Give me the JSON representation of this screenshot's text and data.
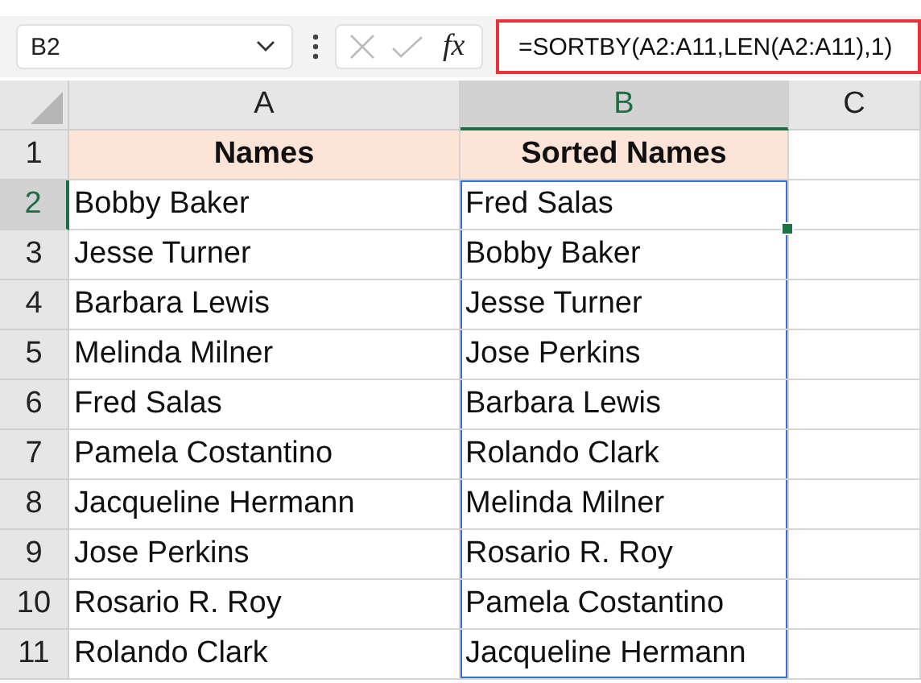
{
  "name_box": {
    "value": "B2"
  },
  "formula_bar": {
    "function_label": "fx",
    "formula": "=SORTBY(A2:A11,LEN(A2:A11),1)",
    "highlighted": true
  },
  "columns": [
    {
      "label": "A",
      "selected": false
    },
    {
      "label": "B",
      "selected": true
    },
    {
      "label": "C",
      "selected": false
    }
  ],
  "rows": [
    {
      "number": "1",
      "selected": false,
      "cells": [
        {
          "text": "Names",
          "kind": "heading",
          "selected": false,
          "in_spill": false
        },
        {
          "text": "Sorted Names",
          "kind": "heading",
          "selected": false,
          "in_spill": false
        }
      ]
    },
    {
      "number": "2",
      "selected": true,
      "cells": [
        {
          "text": "Bobby Baker",
          "kind": "plain",
          "selected": false,
          "in_spill": false
        },
        {
          "text": "Fred Salas",
          "kind": "plain",
          "selected": true,
          "in_spill": true
        }
      ]
    },
    {
      "number": "3",
      "selected": false,
      "cells": [
        {
          "text": "Jesse Turner",
          "kind": "plain",
          "selected": false,
          "in_spill": false
        },
        {
          "text": "Bobby Baker",
          "kind": "plain",
          "selected": false,
          "in_spill": true
        }
      ]
    },
    {
      "number": "4",
      "selected": false,
      "cells": [
        {
          "text": "Barbara Lewis",
          "kind": "plain",
          "selected": false,
          "in_spill": false
        },
        {
          "text": "Jesse Turner",
          "kind": "plain",
          "selected": false,
          "in_spill": true
        }
      ]
    },
    {
      "number": "5",
      "selected": false,
      "cells": [
        {
          "text": "Melinda Milner",
          "kind": "plain",
          "selected": false,
          "in_spill": false
        },
        {
          "text": "Jose Perkins",
          "kind": "plain",
          "selected": false,
          "in_spill": true
        }
      ]
    },
    {
      "number": "6",
      "selected": false,
      "cells": [
        {
          "text": "Fred Salas",
          "kind": "plain",
          "selected": false,
          "in_spill": false
        },
        {
          "text": "Barbara Lewis",
          "kind": "plain",
          "selected": false,
          "in_spill": true
        }
      ]
    },
    {
      "number": "7",
      "selected": false,
      "cells": [
        {
          "text": "Pamela Costantino",
          "kind": "plain",
          "selected": false,
          "in_spill": false
        },
        {
          "text": "Rolando Clark",
          "kind": "plain",
          "selected": false,
          "in_spill": true
        }
      ]
    },
    {
      "number": "8",
      "selected": false,
      "cells": [
        {
          "text": "Jacqueline Hermann",
          "kind": "plain",
          "selected": false,
          "in_spill": false
        },
        {
          "text": "Melinda Milner",
          "kind": "plain",
          "selected": false,
          "in_spill": true
        }
      ]
    },
    {
      "number": "9",
      "selected": false,
      "cells": [
        {
          "text": "Jose Perkins",
          "kind": "plain",
          "selected": false,
          "in_spill": false
        },
        {
          "text": "Rosario R. Roy",
          "kind": "plain",
          "selected": false,
          "in_spill": true
        }
      ]
    },
    {
      "number": "10",
      "selected": false,
      "cells": [
        {
          "text": "Rosario R. Roy",
          "kind": "plain",
          "selected": false,
          "in_spill": false
        },
        {
          "text": "Pamela Costantino",
          "kind": "plain",
          "selected": false,
          "in_spill": true
        }
      ]
    },
    {
      "number": "11",
      "selected": false,
      "cells": [
        {
          "text": "Rolando Clark",
          "kind": "plain",
          "selected": false,
          "in_spill": false
        },
        {
          "text": "Jacqueline Hermann",
          "kind": "plain",
          "selected": false,
          "in_spill": true
        }
      ]
    }
  ]
}
